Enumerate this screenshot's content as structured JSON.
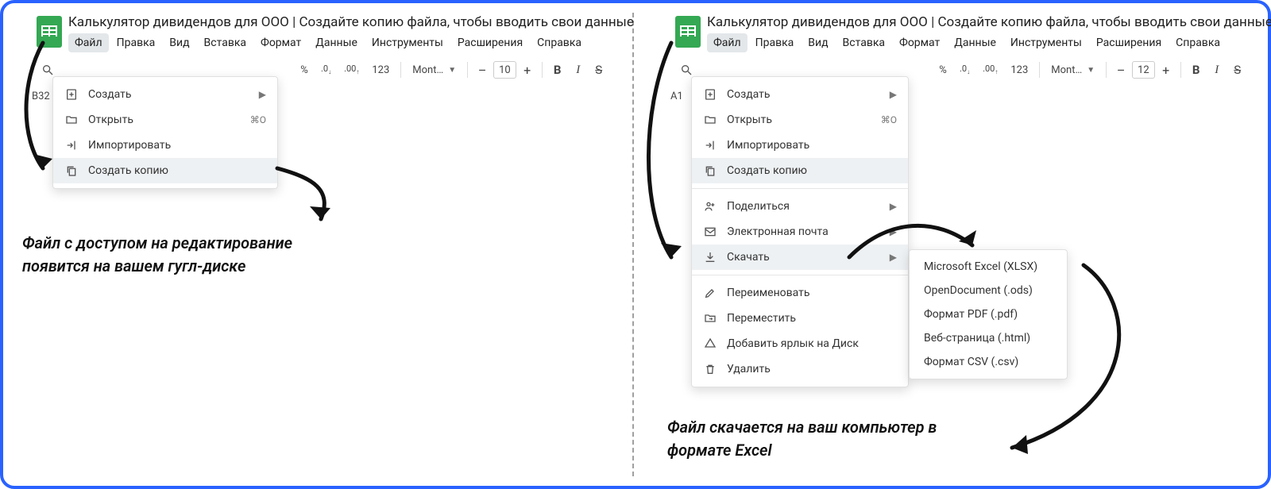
{
  "doc_title": "Калькулятор дивидендов для ООО | Создайте копию файла, чтобы вводить свои данные",
  "menubar": [
    "Файл",
    "Правка",
    "Вид",
    "Вставка",
    "Формат",
    "Данные",
    "Инструменты",
    "Расширения",
    "Справка"
  ],
  "toolbar": {
    "percent": "%",
    "dec_dec": ".0",
    "dec_inc": ".00",
    "num_fmt": "123",
    "font": "Mont…",
    "minus": "–",
    "plus": "+",
    "bold": "B",
    "italic": "I",
    "strike": "S"
  },
  "left": {
    "cellref": "B32",
    "font_size": "10",
    "menu": {
      "create": "Создать",
      "open": "Открыть",
      "open_sc": "⌘O",
      "import": "Импортировать",
      "copy": "Создать копию"
    },
    "caption": "Файл с доступом на редактирование появится на вашем гугл-диске"
  },
  "right": {
    "cellref": "A1",
    "font_size": "12",
    "menu": {
      "create": "Создать",
      "open": "Открыть",
      "open_sc": "⌘O",
      "import": "Импортировать",
      "copy": "Создать копию",
      "share": "Поделиться",
      "email": "Электронная почта",
      "download": "Скачать",
      "rename": "Переименовать",
      "move": "Переместить",
      "shortcut": "Добавить ярлык на Диск",
      "delete": "Удалить"
    },
    "submenu": {
      "xlsx": "Microsoft Excel (XLSX)",
      "ods": "OpenDocument (.ods)",
      "pdf": "Формат PDF (.pdf)",
      "html": "Веб-страница (.html)",
      "csv": "Формат CSV (.csv)"
    },
    "caption": "Файл скачается на ваш компьютер в формате Excel"
  }
}
